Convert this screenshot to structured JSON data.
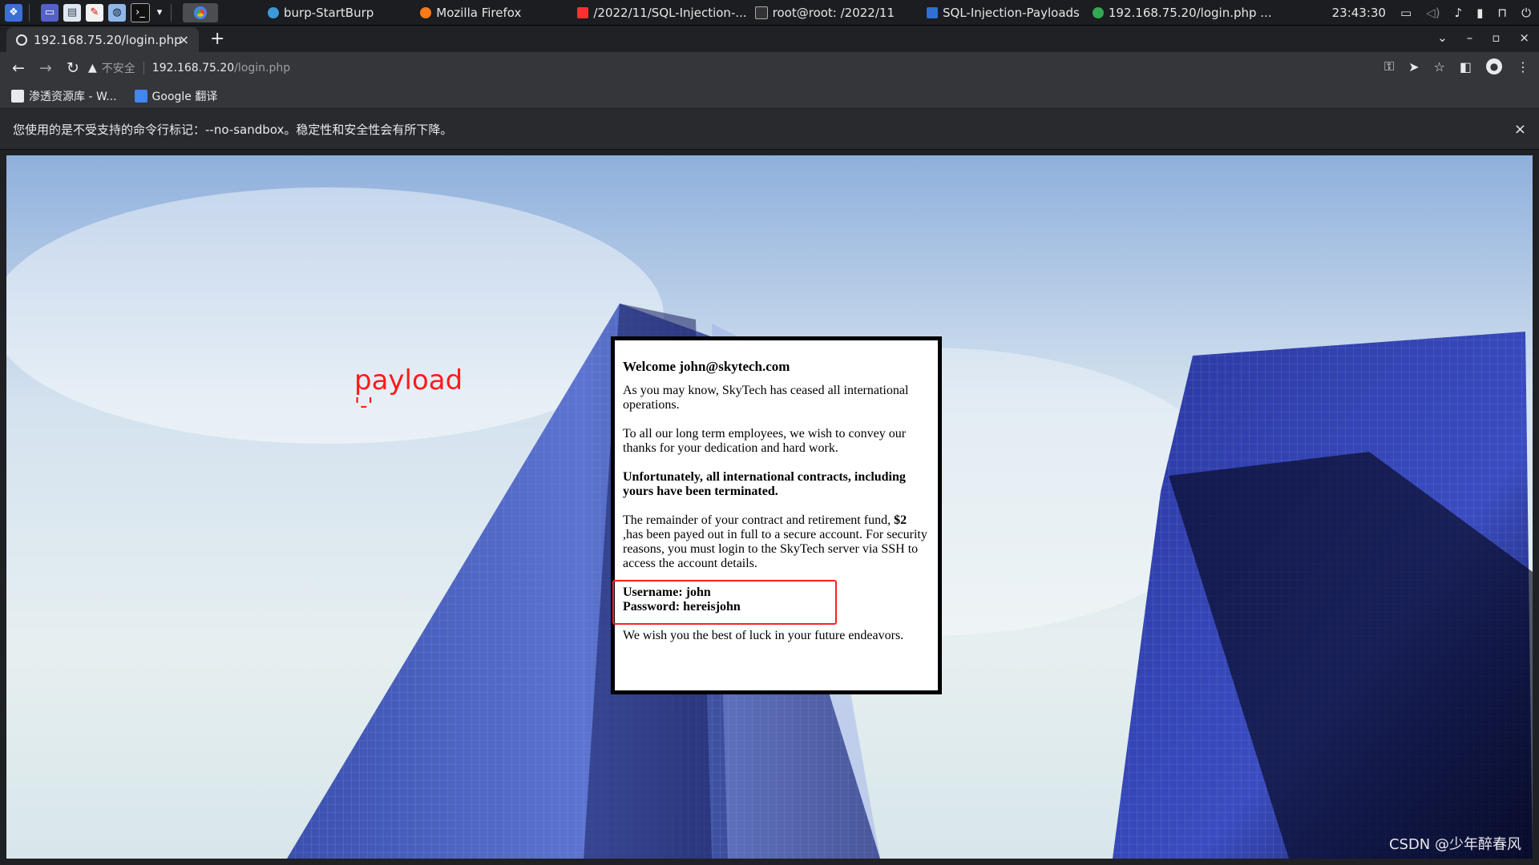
{
  "taskbar": {
    "tasks": [
      {
        "label": "burp-StartBurp",
        "color": "#3c9ad6"
      },
      {
        "label": "Mozilla Firefox",
        "color": "#ff7a18"
      },
      {
        "label": "/2022/11/SQL-Injection-...",
        "color": "#ff3030"
      },
      {
        "label": "root@root: /2022/11",
        "color": "#333333"
      },
      {
        "label": "SQL-Injection-Payloads",
        "color": "#2f6fd6"
      },
      {
        "label": "192.168.75.20/login.php ...",
        "color": "#34a853"
      }
    ],
    "clock": "23:43:30"
  },
  "tab": {
    "title": "192.168.75.20/login.php",
    "close": "×",
    "new_tab": "+"
  },
  "window_controls": {
    "chevron": "⌄",
    "minimize": "–",
    "maximize": "▫",
    "close": "×"
  },
  "toolbar": {
    "back": "←",
    "forward": "→",
    "reload": "↻",
    "security_label": "不安全",
    "url_host": "192.168.75.20",
    "url_path": "/login.php"
  },
  "bookmarks": [
    {
      "label": "渗透资源库 - W..."
    },
    {
      "label": "Google 翻译"
    }
  ],
  "infobar": {
    "message": "您使用的是不受支持的命令行标记：--no-sandbox。稳定性和安全性会有所下降。",
    "close": "×"
  },
  "annotation": {
    "label": "payload",
    "value": "'-'"
  },
  "card": {
    "heading": "Welcome john@skytech.com",
    "para1": "As you may know, SkyTech has ceased all international operations.",
    "para2": "To all our long term employees, we wish to convey our thanks for your dedication and hard work.",
    "para3": "Unfortunately, all international contracts, including yours have been terminated.",
    "para4_pre": "The remainder of your contract and retirement fund, ",
    "para4_amount": "$2",
    "para4_post": " ,has been payed out in full to a secure account. For security reasons, you must login to the SkyTech server via SSH to access the account details.",
    "username_line": "Username: john",
    "password_line": "Password: hereisjohn",
    "closing": "We wish you the best of luck in your future endeavors."
  },
  "watermark": "CSDN @少年醉春风"
}
